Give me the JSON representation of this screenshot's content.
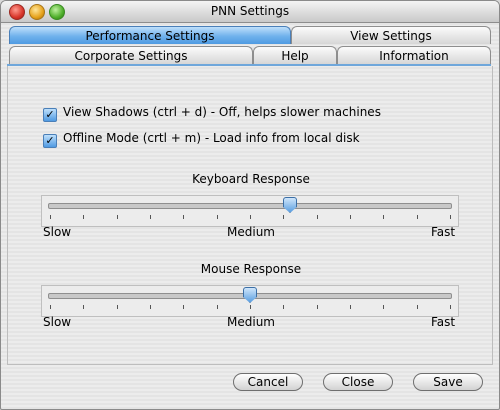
{
  "window": {
    "title": "PNN Settings"
  },
  "tabs": {
    "performance": "Performance Settings",
    "view": "View Settings",
    "corporate": "Corporate Settings",
    "help": "Help",
    "information": "Information"
  },
  "options": {
    "view_shadows": {
      "label": "View Shadows (ctrl + d) - Off, helps slower machines",
      "checked": true
    },
    "offline_mode": {
      "label": "Offline Mode (crtl + m) - Load info from local disk",
      "checked": true
    }
  },
  "keyboard_slider": {
    "title": "Keyboard Response",
    "min_label": "Slow",
    "mid_label": "Medium",
    "max_label": "Fast",
    "value_fraction": 0.6
  },
  "mouse_slider": {
    "title": "Mouse Response",
    "min_label": "Slow",
    "mid_label": "Medium",
    "max_label": "Fast",
    "value_fraction": 0.5
  },
  "buttons": {
    "cancel": "Cancel",
    "close": "Close",
    "save": "Save"
  }
}
